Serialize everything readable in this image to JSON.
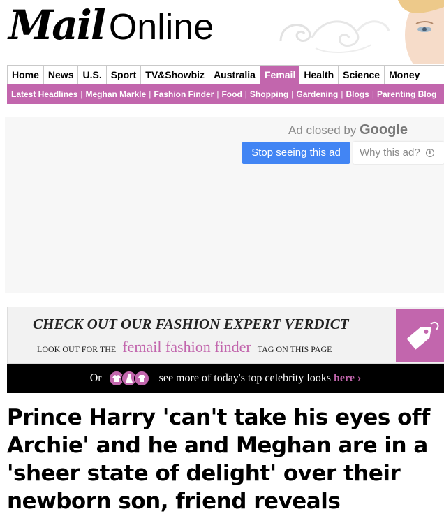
{
  "masthead": {
    "logo_mail": "Mail",
    "logo_online": "Online"
  },
  "primary_nav": {
    "items": [
      {
        "label": "Home"
      },
      {
        "label": "News"
      },
      {
        "label": "U.S."
      },
      {
        "label": "Sport"
      },
      {
        "label": "TV&Showbiz"
      },
      {
        "label": "Australia"
      },
      {
        "label": "Femail",
        "active": true
      },
      {
        "label": "Health"
      },
      {
        "label": "Science"
      },
      {
        "label": "Money"
      }
    ]
  },
  "secondary_nav": {
    "items": [
      {
        "label": "Latest Headlines"
      },
      {
        "label": "Meghan Markle"
      },
      {
        "label": "Fashion Finder"
      },
      {
        "label": "Food"
      },
      {
        "label": "Shopping"
      },
      {
        "label": "Gardening"
      },
      {
        "label": "Blogs"
      },
      {
        "label": "Parenting Blog"
      }
    ]
  },
  "ad": {
    "closed_text": "Ad closed by",
    "provider": "Google",
    "stop_label": "Stop seeing this ad",
    "why_label": "Why this ad?"
  },
  "fashion_banner": {
    "headline": "CHECK OUT OUR FASHION EXPERT VERDICT",
    "look_out": "LOOK OUT FOR THE",
    "brand": "femail fashion finder",
    "tag_text": "TAG ON THIS PAGE"
  },
  "celebrity_bar": {
    "or": "Or",
    "text": "see more of today's top celebrity looks",
    "link": "here"
  },
  "article": {
    "headline": "Prince Harry 'can't take his eyes off Archie' and he and Meghan are in a 'sheer state of delight' over their newborn son, friend reveals"
  },
  "colors": {
    "femail_pink": "#c266ad",
    "google_blue": "#4285f4",
    "black_bar": "#000000"
  }
}
